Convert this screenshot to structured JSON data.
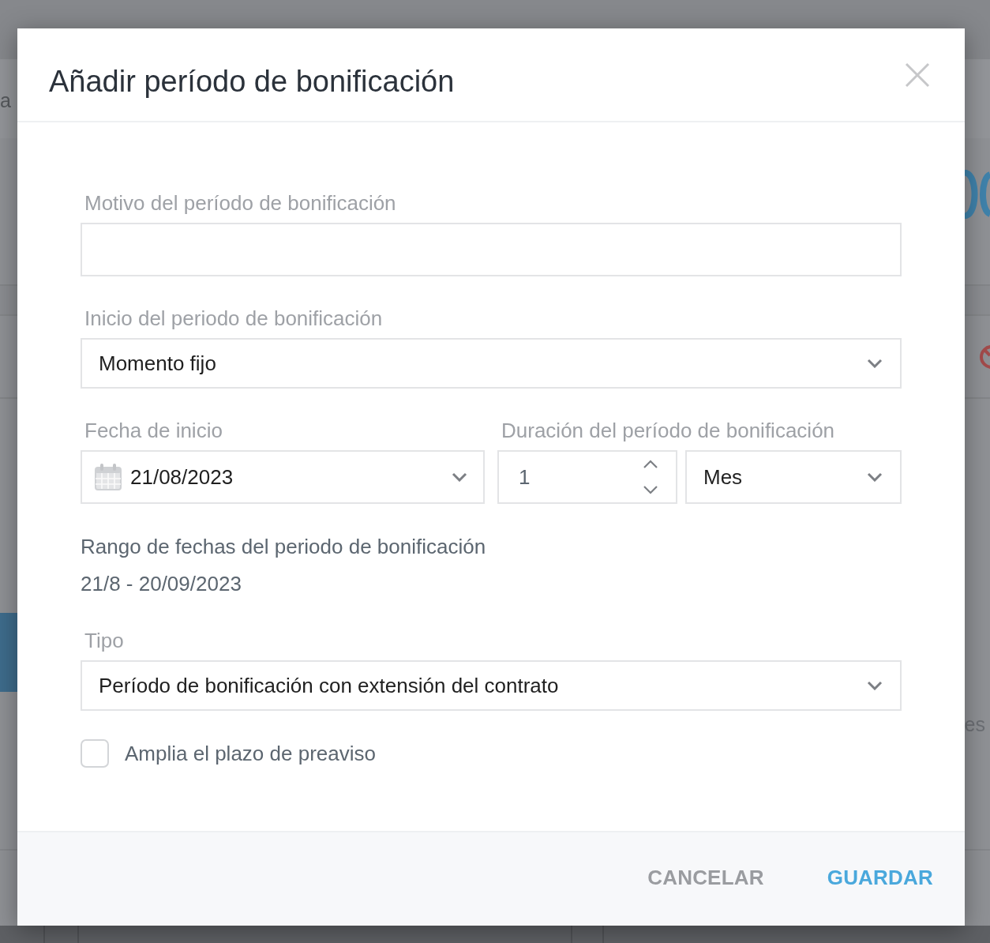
{
  "backdrop": {
    "header_fragment": "a",
    "row_fragment": "es"
  },
  "dialog": {
    "title": "Añadir período de bonificación"
  },
  "form": {
    "reason": {
      "label": "Motivo del período de bonificación"
    },
    "start_mode": {
      "label": "Inicio del periodo de bonificación",
      "value": "Momento fijo"
    },
    "start_date": {
      "label": "Fecha de inicio",
      "value": "21/08/2023"
    },
    "duration": {
      "label": "Duración del período de bonificación",
      "amount": "1",
      "unit": "Mes"
    },
    "date_range": {
      "label": "Rango de fechas del periodo de bonificación",
      "value": "21/8 - 20/09/2023"
    },
    "type": {
      "label": "Tipo",
      "value": "Período de bonificación con extensión del contrato"
    },
    "extend_notice": {
      "label": "Amplia el plazo de preaviso",
      "checked": false
    }
  },
  "buttons": [
    {
      "label": "CANCELAR",
      "kind": "secondary"
    },
    {
      "label": "GUARDAR",
      "kind": "primary"
    }
  ]
}
